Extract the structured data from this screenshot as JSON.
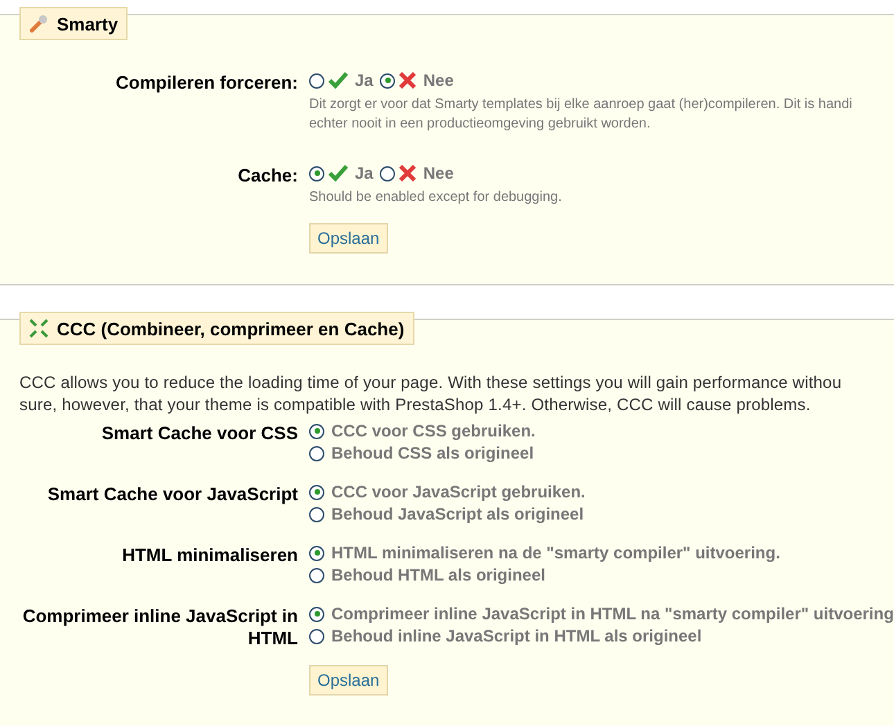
{
  "sections": [
    {
      "title": "Smarty",
      "fields": [
        {
          "label": "Compileren forceren:",
          "kind": "yesno",
          "options": [
            {
              "label": "Ja",
              "selected": false
            },
            {
              "label": "Nee",
              "selected": true
            }
          ],
          "description": "Dit zorgt er voor dat Smarty templates bij elke aanroep gaat (her)compileren. Dit is handi",
          "description_2": "echter nooit in een productieomgeving gebruikt worden."
        },
        {
          "label": "Cache:",
          "kind": "yesno",
          "options": [
            {
              "label": "Ja",
              "selected": true
            },
            {
              "label": "Nee",
              "selected": false
            }
          ],
          "description": "Should be enabled except for debugging."
        }
      ],
      "button": "Opslaan"
    },
    {
      "title": "CCC (Combineer, comprimeer en Cache)",
      "intro": "CCC allows you to reduce the loading time of your page. With these settings you will gain performance withou",
      "intro_2": "sure, however, that your theme is compatible with PrestaShop 1.4+. Otherwise, CCC will cause problems.",
      "fields": [
        {
          "label": "Smart Cache voor CSS",
          "kind": "list",
          "options": [
            {
              "label": "CCC voor CSS gebruiken.",
              "selected": true
            },
            {
              "label": "Behoud CSS als origineel",
              "selected": false
            }
          ]
        },
        {
          "label": "Smart Cache voor JavaScript",
          "kind": "list",
          "options": [
            {
              "label": "CCC voor JavaScript gebruiken.",
              "selected": true
            },
            {
              "label": "Behoud JavaScript als origineel",
              "selected": false
            }
          ]
        },
        {
          "label": "HTML minimaliseren",
          "kind": "list",
          "options": [
            {
              "label": "HTML minimaliseren na de \"smarty compiler\" uitvoering.",
              "selected": true
            },
            {
              "label": "Behoud HTML als origineel",
              "selected": false
            }
          ]
        },
        {
          "label": "Comprimeer inline JavaScript in HTML",
          "kind": "list",
          "options": [
            {
              "label": "Comprimeer inline JavaScript in HTML na \"smarty compiler\" uitvoering",
              "selected": true
            },
            {
              "label": "Behoud inline JavaScript in HTML als origineel",
              "selected": false
            }
          ]
        }
      ],
      "button": "Opslaan"
    }
  ]
}
